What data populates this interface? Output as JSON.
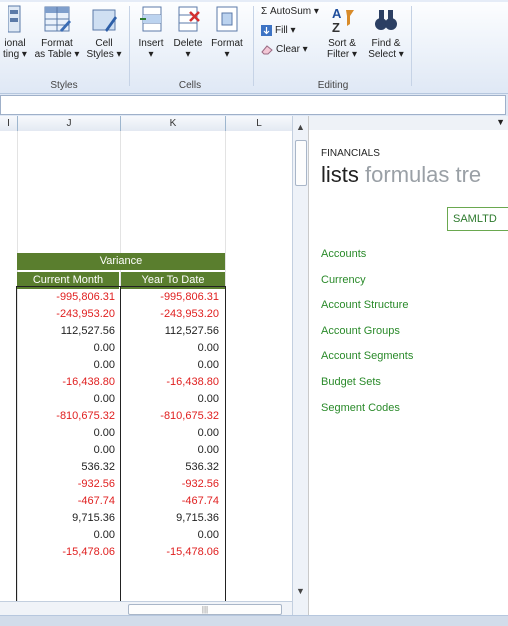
{
  "ribbon": {
    "styles": {
      "conditional_label": [
        "ional",
        "ting ▾"
      ],
      "format_table_label": [
        "Format",
        "as Table ▾"
      ],
      "cell_styles_label": [
        "Cell",
        "Styles ▾"
      ],
      "group_label": "Styles"
    },
    "cells": {
      "insert_label": "Insert",
      "delete_label": "Delete",
      "format_label": "Format",
      "group_label": "Cells"
    },
    "editing": {
      "autosum_label": "Σ AutoSum ▾",
      "fill_label": "Fill ▾",
      "clear_label": "Clear ▾",
      "sort_filter_label": [
        "Sort &",
        "Filter ▾"
      ],
      "find_select_label": [
        "Find &",
        "Select ▾"
      ],
      "group_label": "Editing"
    }
  },
  "columns": [
    "I",
    "J",
    "K",
    "L"
  ],
  "sheet": {
    "header_top": "Variance",
    "header_cols": [
      "Current Month",
      "Year To Date"
    ],
    "rows": [
      {
        "cm": "-995,806.31",
        "ytd": "-995,806.31",
        "neg": true
      },
      {
        "cm": "-243,953.20",
        "ytd": "-243,953.20",
        "neg": true
      },
      {
        "cm": "112,527.56",
        "ytd": "112,527.56",
        "neg": false
      },
      {
        "cm": "0.00",
        "ytd": "0.00",
        "neg": false
      },
      {
        "cm": "0.00",
        "ytd": "0.00",
        "neg": false
      },
      {
        "cm": "-16,438.80",
        "ytd": "-16,438.80",
        "neg": true
      },
      {
        "cm": "0.00",
        "ytd": "0.00",
        "neg": false
      },
      {
        "cm": "-810,675.32",
        "ytd": "-810,675.32",
        "neg": true
      },
      {
        "cm": "0.00",
        "ytd": "0.00",
        "neg": false
      },
      {
        "cm": "0.00",
        "ytd": "0.00",
        "neg": false
      },
      {
        "cm": "536.32",
        "ytd": "536.32",
        "neg": false
      },
      {
        "cm": "-932.56",
        "ytd": "-932.56",
        "neg": true
      },
      {
        "cm": "-467.74",
        "ytd": "-467.74",
        "neg": true
      },
      {
        "cm": "9,715.36",
        "ytd": "9,715.36",
        "neg": false
      },
      {
        "cm": "0.00",
        "ytd": "0.00",
        "neg": false
      },
      {
        "cm": "-15,478.06",
        "ytd": "-15,478.06",
        "neg": true
      }
    ]
  },
  "pane": {
    "heading": "FINANCIALS",
    "tab_active": "lists",
    "tab_inactive": "formulas tre",
    "company": "SAMLTD",
    "links": [
      "Accounts",
      "Currency",
      "Account Structure",
      "Account Groups",
      "Account Segments",
      "Budget Sets",
      "Segment Codes"
    ]
  },
  "colors": {
    "header_green": "#5a7e2e",
    "negative_red": "#e02020",
    "link_green": "#2a8a2a"
  }
}
